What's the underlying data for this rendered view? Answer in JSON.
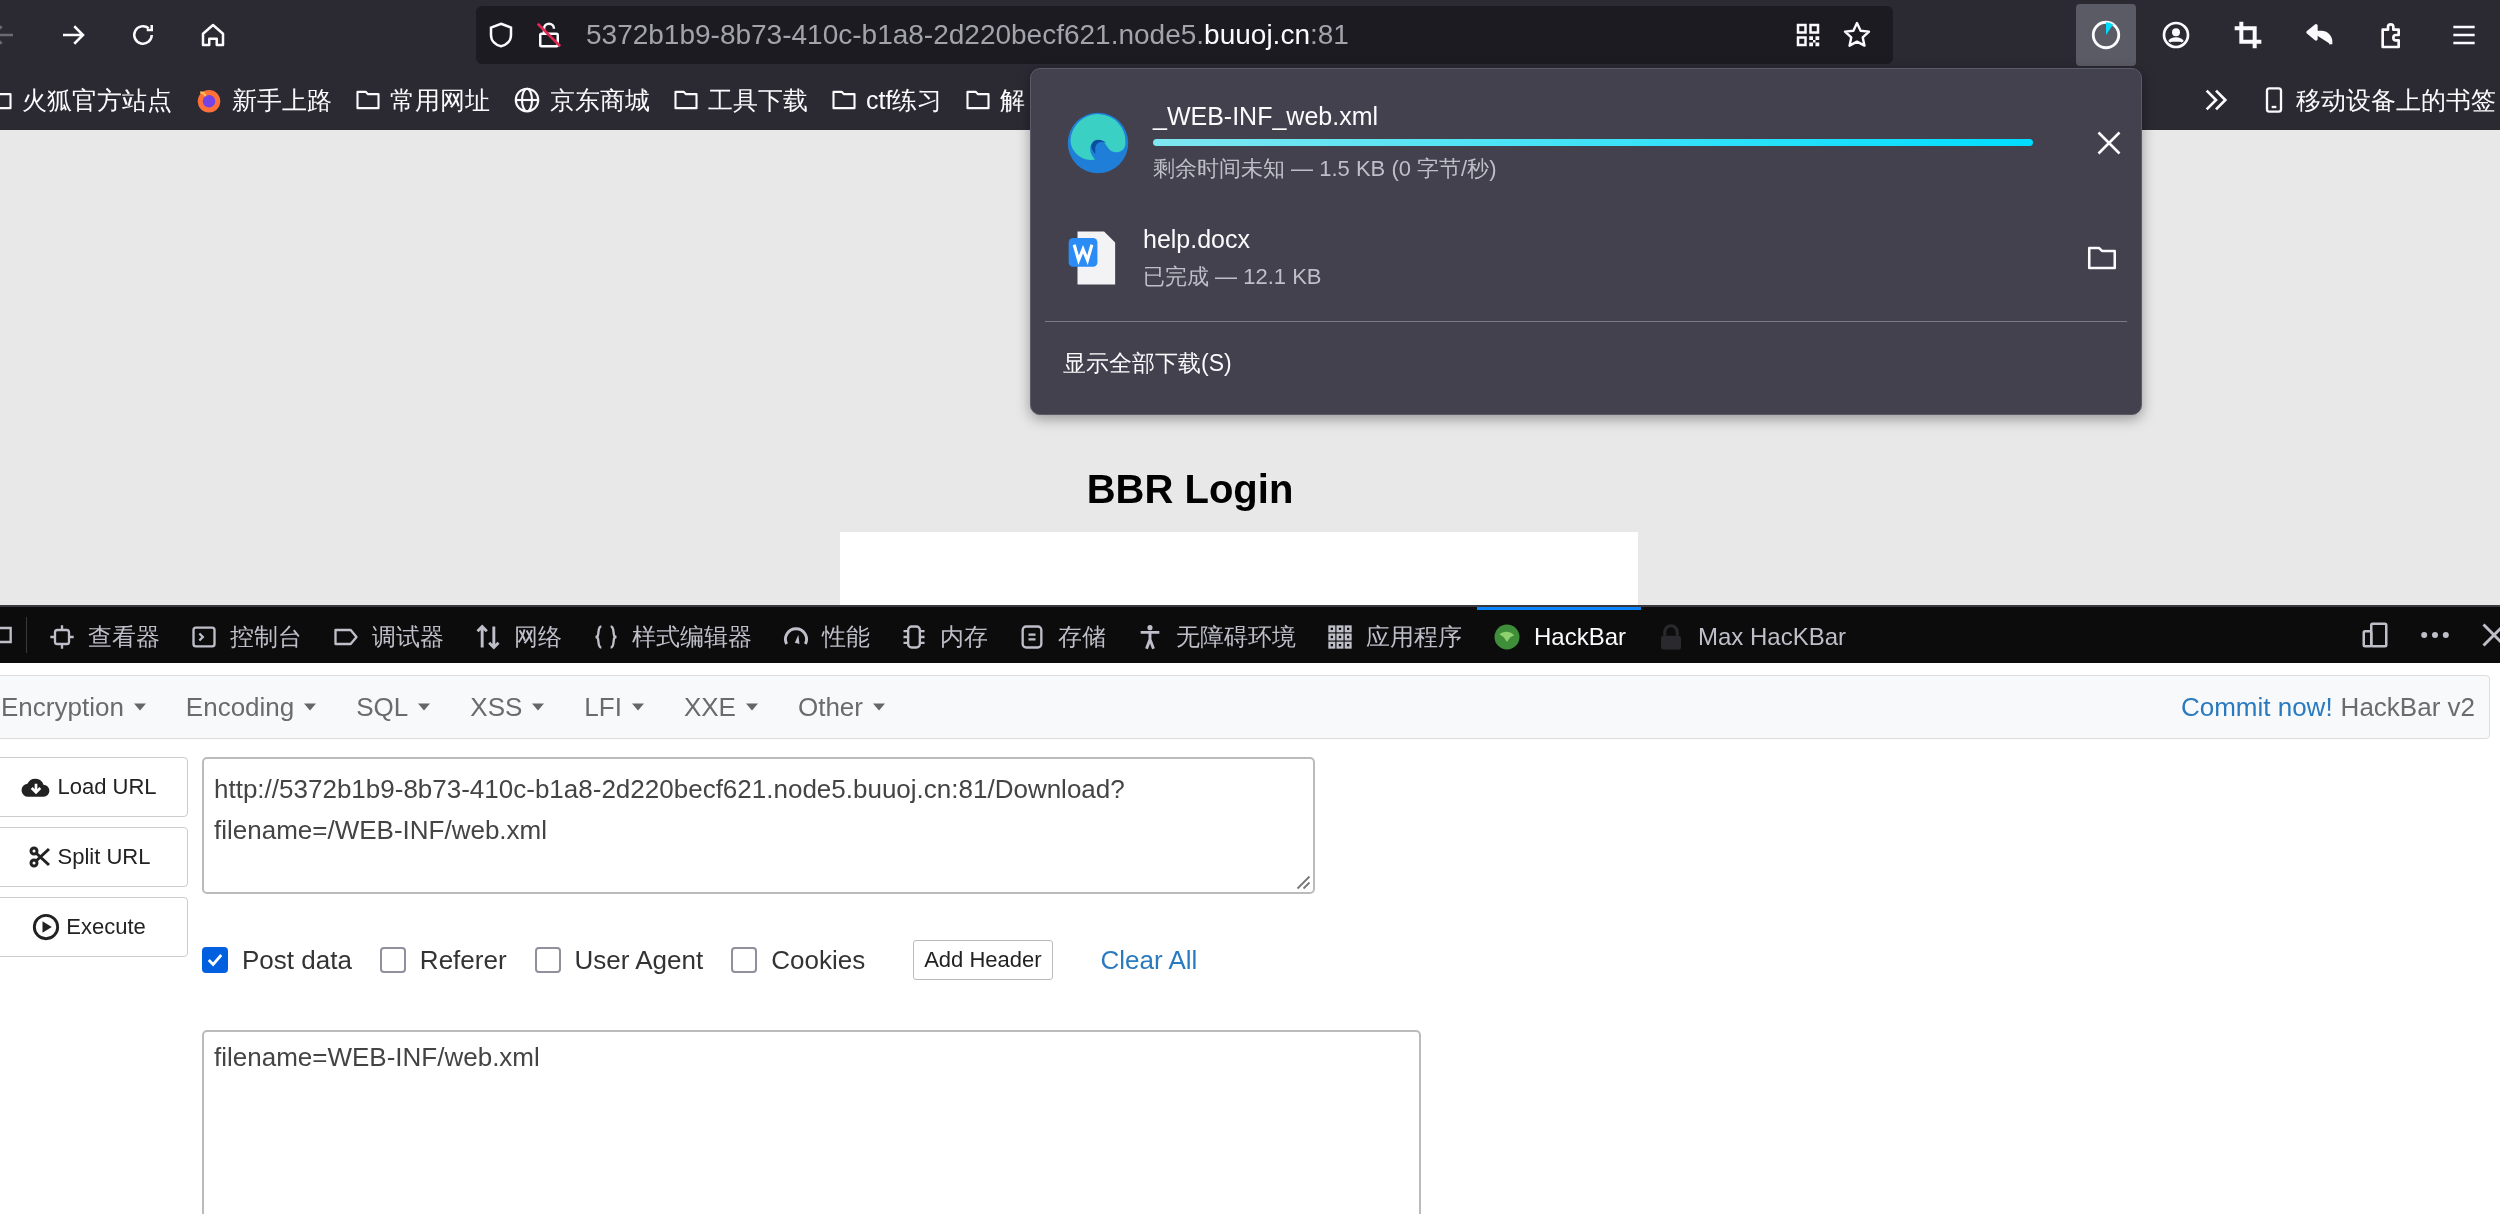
{
  "toolbar": {
    "url": {
      "host": "5372b1b9-8b73-410c-b1a8-2d220becf621.node5.",
      "domain": "buuoj.cn",
      "port": ":81"
    }
  },
  "bookmarks": [
    {
      "kind": "folder",
      "label": "火狐官方站点"
    },
    {
      "kind": "firefox",
      "label": "新手上路"
    },
    {
      "kind": "folder",
      "label": "常用网址"
    },
    {
      "kind": "globe",
      "label": "京东商城"
    },
    {
      "kind": "folder",
      "label": "工具下载"
    },
    {
      "kind": "folder",
      "label": "ctf练习"
    },
    {
      "kind": "folder",
      "label": "解"
    }
  ],
  "mobile_bookmarks": "移动设备上的书签",
  "downloads": {
    "items": [
      {
        "kind": "progress",
        "file": "_WEB-INF_web.xml",
        "status": "剩余时间未知 — 1.5 KB (0 字节/秒)",
        "level": 1
      },
      {
        "kind": "done",
        "file": "help.docx",
        "status": "已完成 — 12.1 KB"
      }
    ],
    "show_all": "显示全部下载(S)"
  },
  "page": {
    "heading": "BBR Login"
  },
  "devtools": {
    "tabs": [
      {
        "kind": "inspector",
        "label": "查看器",
        "selected": false
      },
      {
        "kind": "console",
        "label": "控制台",
        "selected": false
      },
      {
        "kind": "debugger",
        "label": "调试器",
        "selected": false
      },
      {
        "kind": "network",
        "label": "网络",
        "selected": false
      },
      {
        "kind": "style",
        "label": "样式编辑器",
        "selected": false
      },
      {
        "kind": "performance",
        "label": "性能",
        "selected": false
      },
      {
        "kind": "memory",
        "label": "内存",
        "selected": false
      },
      {
        "kind": "storage",
        "label": "存储",
        "selected": false
      },
      {
        "kind": "accessibility",
        "label": "无障碍环境",
        "selected": false
      },
      {
        "kind": "application",
        "label": "应用程序",
        "selected": false
      },
      {
        "kind": "hackbar",
        "label": "HackBar",
        "selected": true
      },
      {
        "kind": "maxhackbar",
        "label": "Max HacKBar",
        "selected": false
      }
    ]
  },
  "hackbar": {
    "menus": [
      "Encryption",
      "Encoding",
      "SQL",
      "XSS",
      "LFI",
      "XXE",
      "Other"
    ],
    "commit_link": "Commit now!",
    "version": "HackBar v2",
    "actions": [
      {
        "kind": "load",
        "label": "Load URL"
      },
      {
        "kind": "split",
        "label": "Split URL"
      },
      {
        "kind": "execute",
        "label": "Execute"
      }
    ],
    "url": "http://5372b1b9-8b73-410c-b1a8-2d220becf621.node5.buuoj.cn:81/Download?filename=/WEB-INF/web.xml",
    "options": [
      {
        "label": "Post data",
        "checked": true
      },
      {
        "label": "Referer",
        "checked": false
      },
      {
        "label": "User Agent",
        "checked": false
      },
      {
        "label": "Cookies",
        "checked": false
      }
    ],
    "add_header": "Add Header",
    "clear_all": "Clear All",
    "post_data": "filename=WEB-INF/web.xml"
  }
}
